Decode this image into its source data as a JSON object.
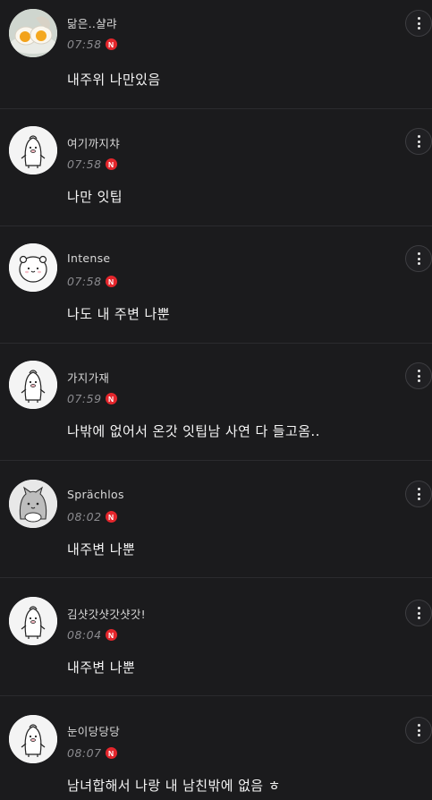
{
  "comments": [
    {
      "nick": "닮은..샬랴",
      "time": "07:58",
      "badge": "N",
      "text": "내주위 나만있음",
      "avatar": "egg-avatar"
    },
    {
      "nick": "여기까지챠",
      "time": "07:58",
      "badge": "N",
      "text": "나만 잇팁",
      "avatar": "penguin-avatar"
    },
    {
      "nick": "Intense",
      "time": "07:58",
      "badge": "N",
      "text": "나도 내 주변 나뿐",
      "avatar": "bear-avatar"
    },
    {
      "nick": "가지가재",
      "time": "07:59",
      "badge": "N",
      "text": "나밖에 없어서 온갓 잇팁남 사연 다 들고옴..",
      "avatar": "penguin-avatar"
    },
    {
      "nick": "Sprächlos",
      "time": "08:02",
      "badge": "N",
      "text": "내주변 나뿐",
      "avatar": "cat-avatar"
    },
    {
      "nick": "김샷갓샷갓샷갓!",
      "time": "08:04",
      "badge": "N",
      "text": "내주변 나뿐",
      "avatar": "penguin-avatar"
    },
    {
      "nick": "눈이당당당",
      "time": "08:07",
      "badge": "N",
      "text": "남녀합해서 나랑 내 남친밖에 없음 ㅎ",
      "avatar": "penguin-avatar"
    }
  ],
  "colors": {
    "background": "#1b1b1d",
    "badge": "#e4262c",
    "divider": "#2b2b2e"
  },
  "icons": {
    "more": "more-vertical-icon",
    "new_badge": "new-badge"
  }
}
